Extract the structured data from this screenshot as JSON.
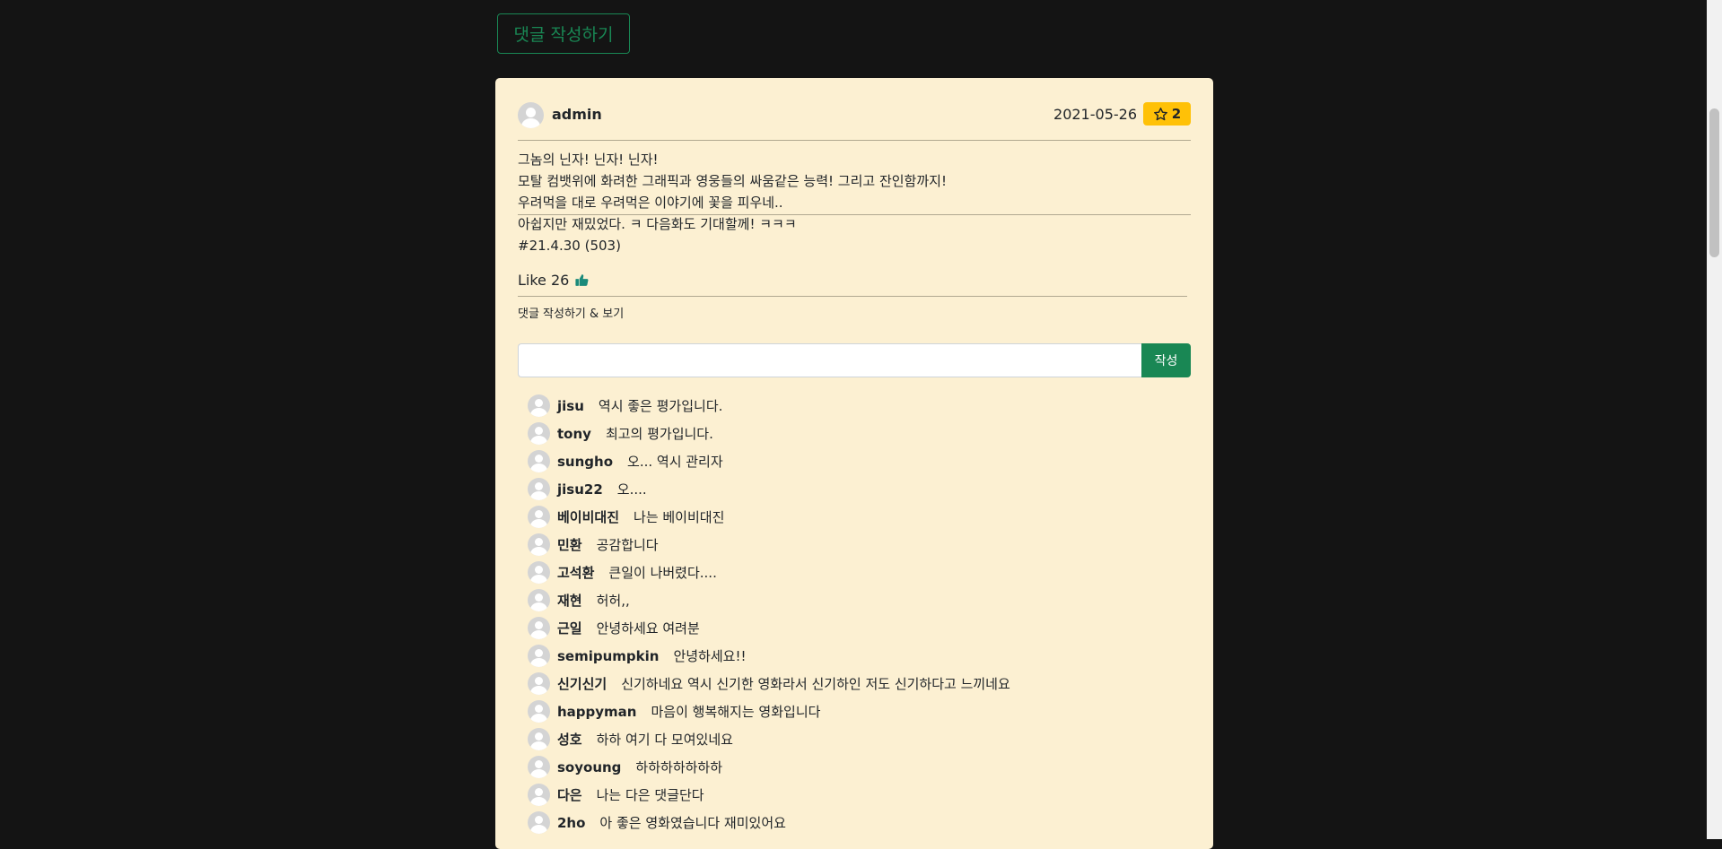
{
  "top_button_label": "댓글 작성하기",
  "post": {
    "author": "admin",
    "date": "2021-05-26",
    "rating": "2",
    "content": "그놈의 닌자! 닌자! 닌자!\n모탈 컴뱃위에 화려한 그래픽과 영웅들의 싸움같은 능력! 그리고 잔인함까지!\n우려먹을 대로 우려먹은 이야기에 꽃을 피우네..\n아쉽지만 재밌었다. ㅋ 다음화도 기대할께! ㅋㅋㅋ\n#21.4.30 (503)",
    "like_label": "Like 26",
    "comment_link": "댓글 작성하기 & 보기"
  },
  "comment_form": {
    "submit_label": "작성"
  },
  "comments": [
    {
      "user": "jisu",
      "text": "역시 좋은 평가입니다."
    },
    {
      "user": "tony",
      "text": "최고의 평가입니다."
    },
    {
      "user": "sungho",
      "text": "오... 역시 관리자"
    },
    {
      "user": "jisu22",
      "text": "오...."
    },
    {
      "user": "베이비대진",
      "text": "나는 베이비대진"
    },
    {
      "user": "민환",
      "text": "공감합니다"
    },
    {
      "user": "고석환",
      "text": "큰일이 나버렸다...."
    },
    {
      "user": "재현",
      "text": "허허,,"
    },
    {
      "user": "근일",
      "text": "안녕하세요 여려분"
    },
    {
      "user": "semipumpkin",
      "text": "안녕하세요!!"
    },
    {
      "user": "신기신기",
      "text": "신기하네요 역시 신기한 영화라서 신기하인 저도 신기하다고 느끼네요"
    },
    {
      "user": "happyman",
      "text": "마음이 행복해지는 영화입니다"
    },
    {
      "user": "성호",
      "text": "하하 여기 다 모여있네요"
    },
    {
      "user": "soyoung",
      "text": "하하하하하하하"
    },
    {
      "user": "다은",
      "text": "나는 다은 댓글단다"
    },
    {
      "user": "2ho",
      "text": "아 좋은 영화였습니다 재미있어요"
    }
  ],
  "colors": {
    "accent": "#198754",
    "badge": "#ffc107",
    "card": "#fcf0d2",
    "background": "#141414",
    "like_icon": "#1a8a7a"
  },
  "icons": {
    "rating": "star-icon",
    "like": "thumbs-up-icon",
    "avatar": "user-avatar-icon"
  }
}
